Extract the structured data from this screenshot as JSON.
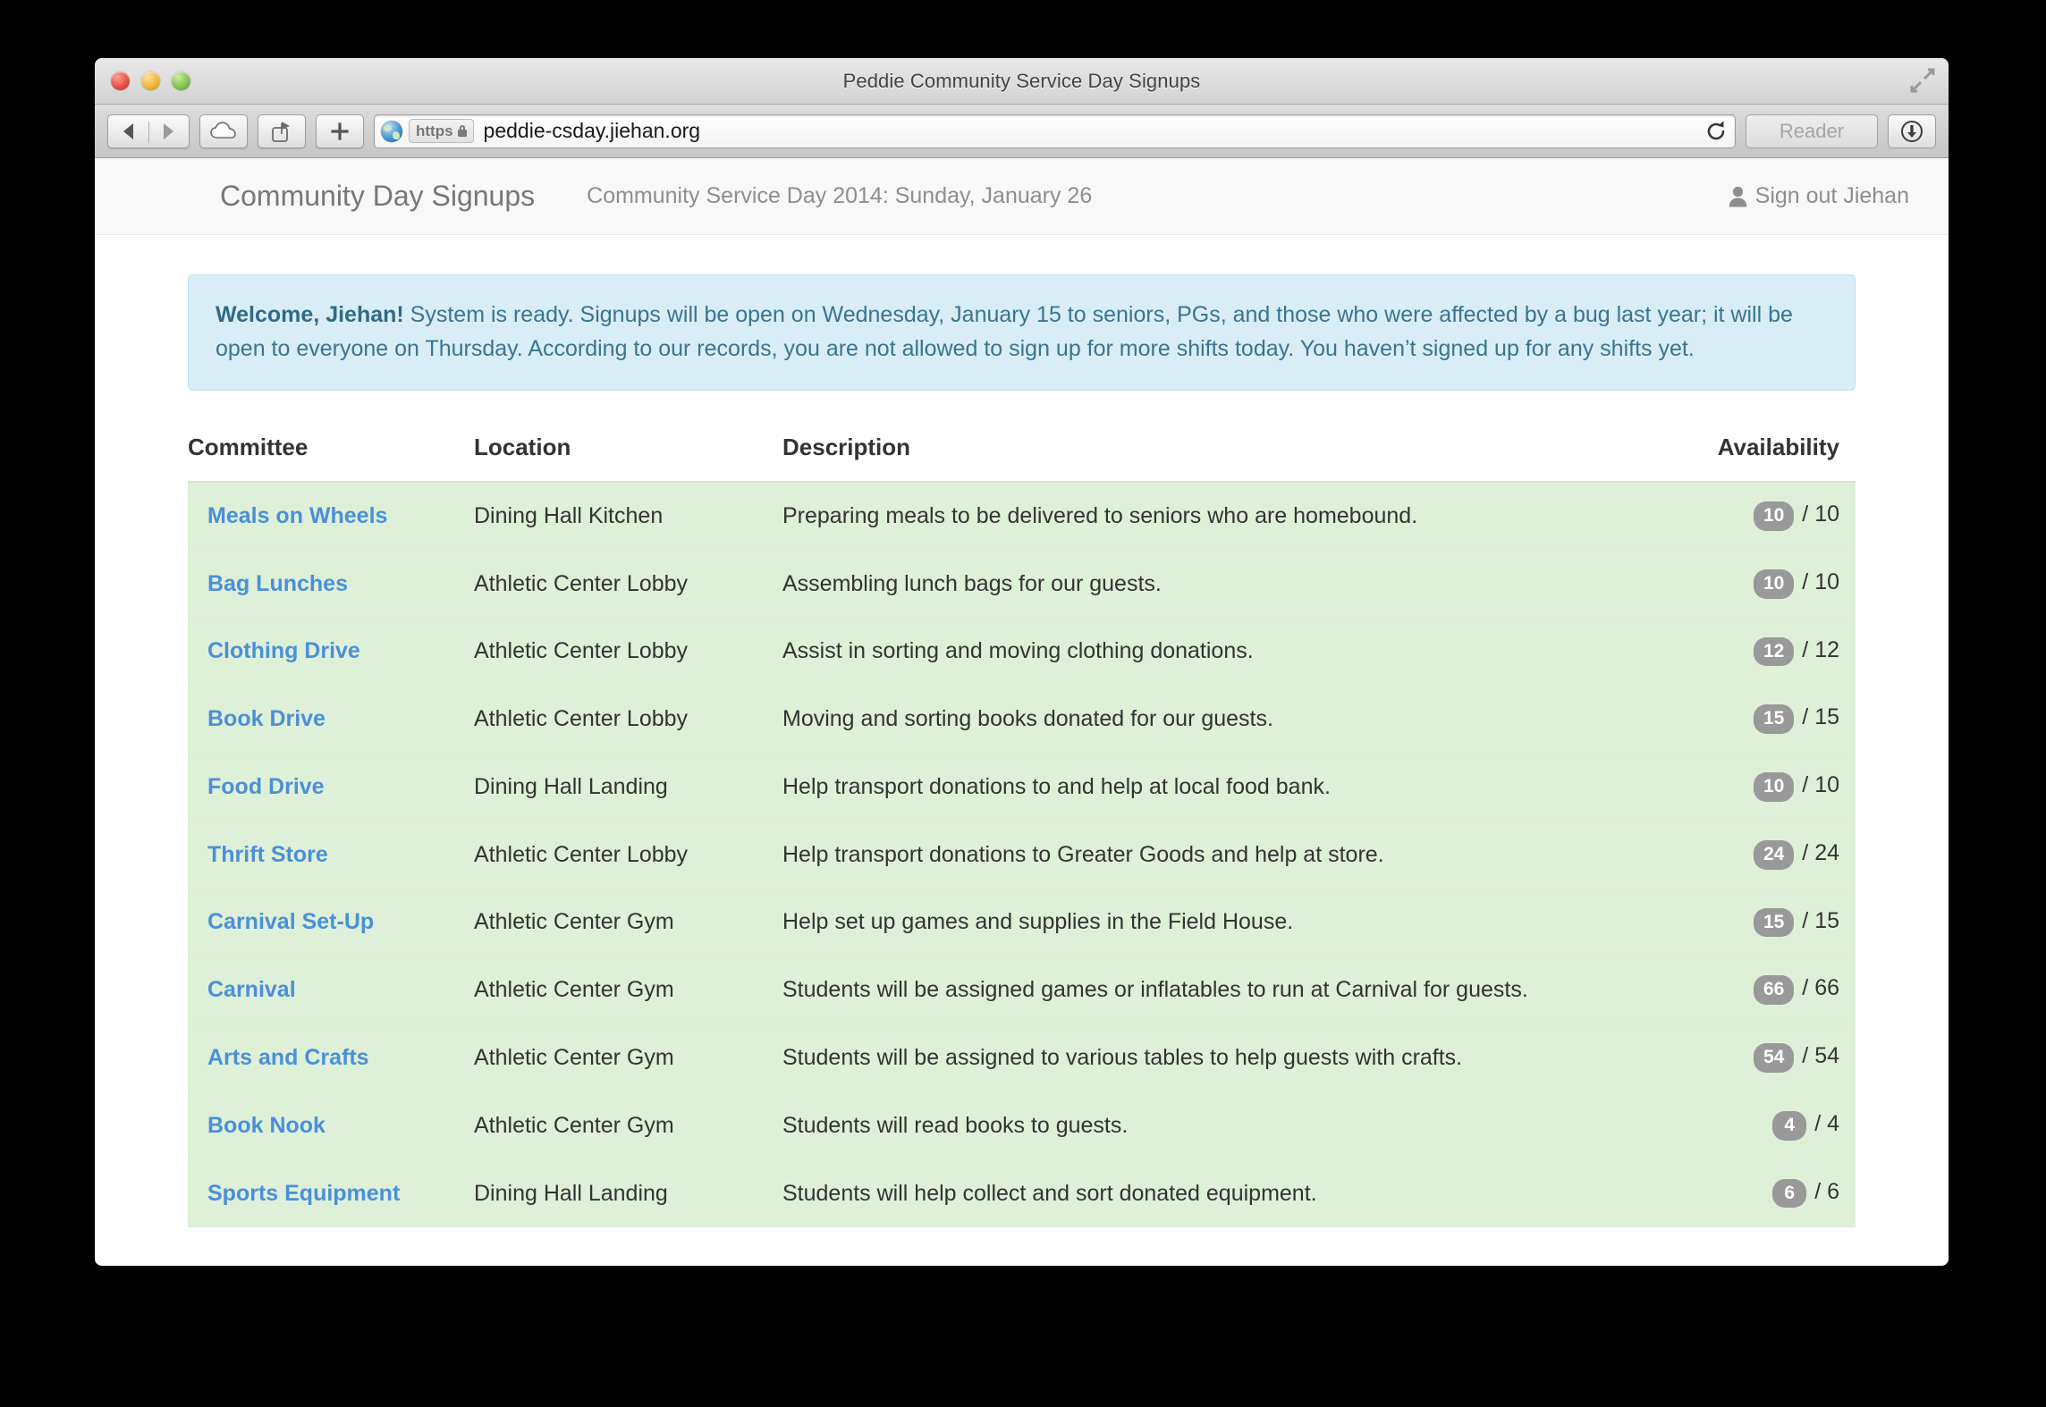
{
  "window": {
    "title": "Peddie Community Service Day Signups",
    "traffic_lights": [
      "close",
      "minimize",
      "zoom"
    ]
  },
  "toolbar": {
    "back_label": "Back",
    "forward_label": "Forward",
    "icloud_label": "iCloud Tabs",
    "share_label": "Share",
    "new_tab_label": "New Tab",
    "scheme": "https",
    "url": "peddie-csday.jiehan.org",
    "reload_label": "Reload",
    "reader_label": "Reader",
    "downloads_label": "Downloads"
  },
  "navbar": {
    "brand": "Community Day Signups",
    "subtitle": "Community Service Day 2014: Sunday, January 26",
    "signout_label": "Sign out Jiehan"
  },
  "alert": {
    "greeting": "Welcome, Jiehan!",
    "message": "System is ready.  Signups will be open on Wednesday, January 15 to seniors, PGs, and those who were affected by a bug last year; it will be open to everyone on Thursday.  According to our records, you are not allowed to sign up for more shifts today.  You haven’t signed up for any shifts yet.",
    "background_color": "#d9edf7",
    "text_color": "#39758f"
  },
  "table": {
    "columns": [
      "Committee",
      "Location",
      "Description",
      "Availability"
    ],
    "row_color": "#dff0d8",
    "link_color": "#4a90d9",
    "badge_color": "#999999",
    "rows": [
      {
        "committee": "Meals on Wheels",
        "location": "Dining Hall Kitchen",
        "description": "Preparing meals to be delivered to seniors who are homebound.",
        "open": "10",
        "total": "/ 10"
      },
      {
        "committee": "Bag Lunches",
        "location": "Athletic Center Lobby",
        "description": "Assembling lunch bags for our guests.",
        "open": "10",
        "total": "/ 10"
      },
      {
        "committee": "Clothing Drive",
        "location": "Athletic Center Lobby",
        "description": "Assist in sorting and moving clothing donations.",
        "open": "12",
        "total": "/ 12"
      },
      {
        "committee": "Book Drive",
        "location": "Athletic Center Lobby",
        "description": "Moving and sorting books donated for our guests.",
        "open": "15",
        "total": "/ 15"
      },
      {
        "committee": "Food Drive",
        "location": "Dining Hall Landing",
        "description": "Help transport donations to and help at local food bank.",
        "open": "10",
        "total": "/ 10"
      },
      {
        "committee": "Thrift Store",
        "location": "Athletic Center Lobby",
        "description": "Help transport donations to Greater Goods and help at store.",
        "open": "24",
        "total": "/ 24"
      },
      {
        "committee": "Carnival Set-Up",
        "location": "Athletic Center Gym",
        "description": "Help set up games and supplies in the Field House.",
        "open": "15",
        "total": "/ 15"
      },
      {
        "committee": "Carnival",
        "location": "Athletic Center Gym",
        "description": "Students will be assigned games or inflatables to run at Carnival for guests.",
        "open": "66",
        "total": "/ 66"
      },
      {
        "committee": "Arts and Crafts",
        "location": "Athletic Center Gym",
        "description": "Students will be assigned to various tables to help guests with crafts.",
        "open": "54",
        "total": "/ 54"
      },
      {
        "committee": "Book Nook",
        "location": "Athletic Center Gym",
        "description": "Students will read books to guests.",
        "open": "4",
        "total": "/ 4"
      },
      {
        "committee": "Sports Equipment",
        "location": "Dining Hall Landing",
        "description": "Students will help collect and sort donated equipment.",
        "open": "6",
        "total": "/ 6"
      }
    ]
  }
}
